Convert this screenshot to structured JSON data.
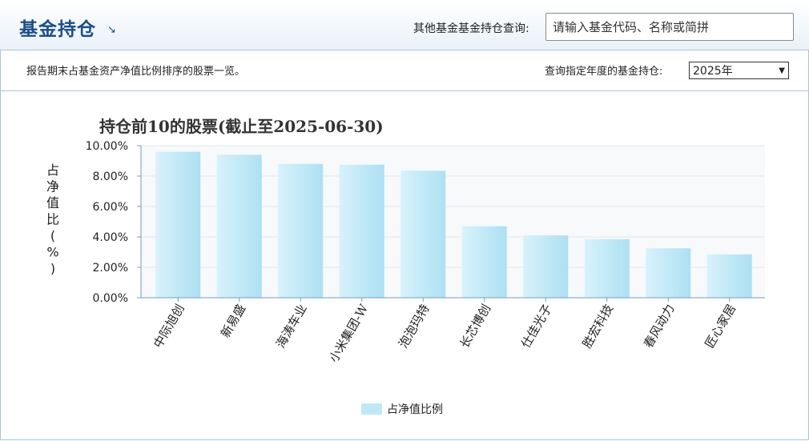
{
  "header": {
    "title": "基金持仓",
    "title_icon": "external-link-arrow-icon",
    "query_label": "其他基金基金持仓查询:",
    "search_placeholder": "请输入基金代码、名称或简拼"
  },
  "subbar": {
    "description": "报告期末占基金资产净值比例排序的股票一览。",
    "year_label": "查询指定年度的基金持仓:",
    "year_selected": "2025年"
  },
  "chart_data": {
    "type": "bar",
    "title": "持仓前10的股票(截止至2025-06-30)",
    "ylabel": "占净值比(%)",
    "xlabel": "",
    "categories": [
      "中际旭创",
      "新易盛",
      "海涛车业",
      "小米集团-W",
      "泡泡玛特",
      "长芯博创",
      "仕佳光子",
      "胜宏科技",
      "春风动力",
      "匠心家居"
    ],
    "series": [
      {
        "name": "占净值比例",
        "values": [
          9.6,
          9.4,
          8.8,
          8.75,
          8.35,
          4.7,
          4.1,
          3.85,
          3.25,
          2.85
        ]
      }
    ],
    "yticks": [
      "0.00%",
      "2.00%",
      "4.00%",
      "6.00%",
      "8.00%",
      "10.00%"
    ],
    "ylim": [
      0,
      10
    ],
    "grid": true,
    "legend_position": "bottom-center",
    "bar_color": "#bfe8f7"
  }
}
